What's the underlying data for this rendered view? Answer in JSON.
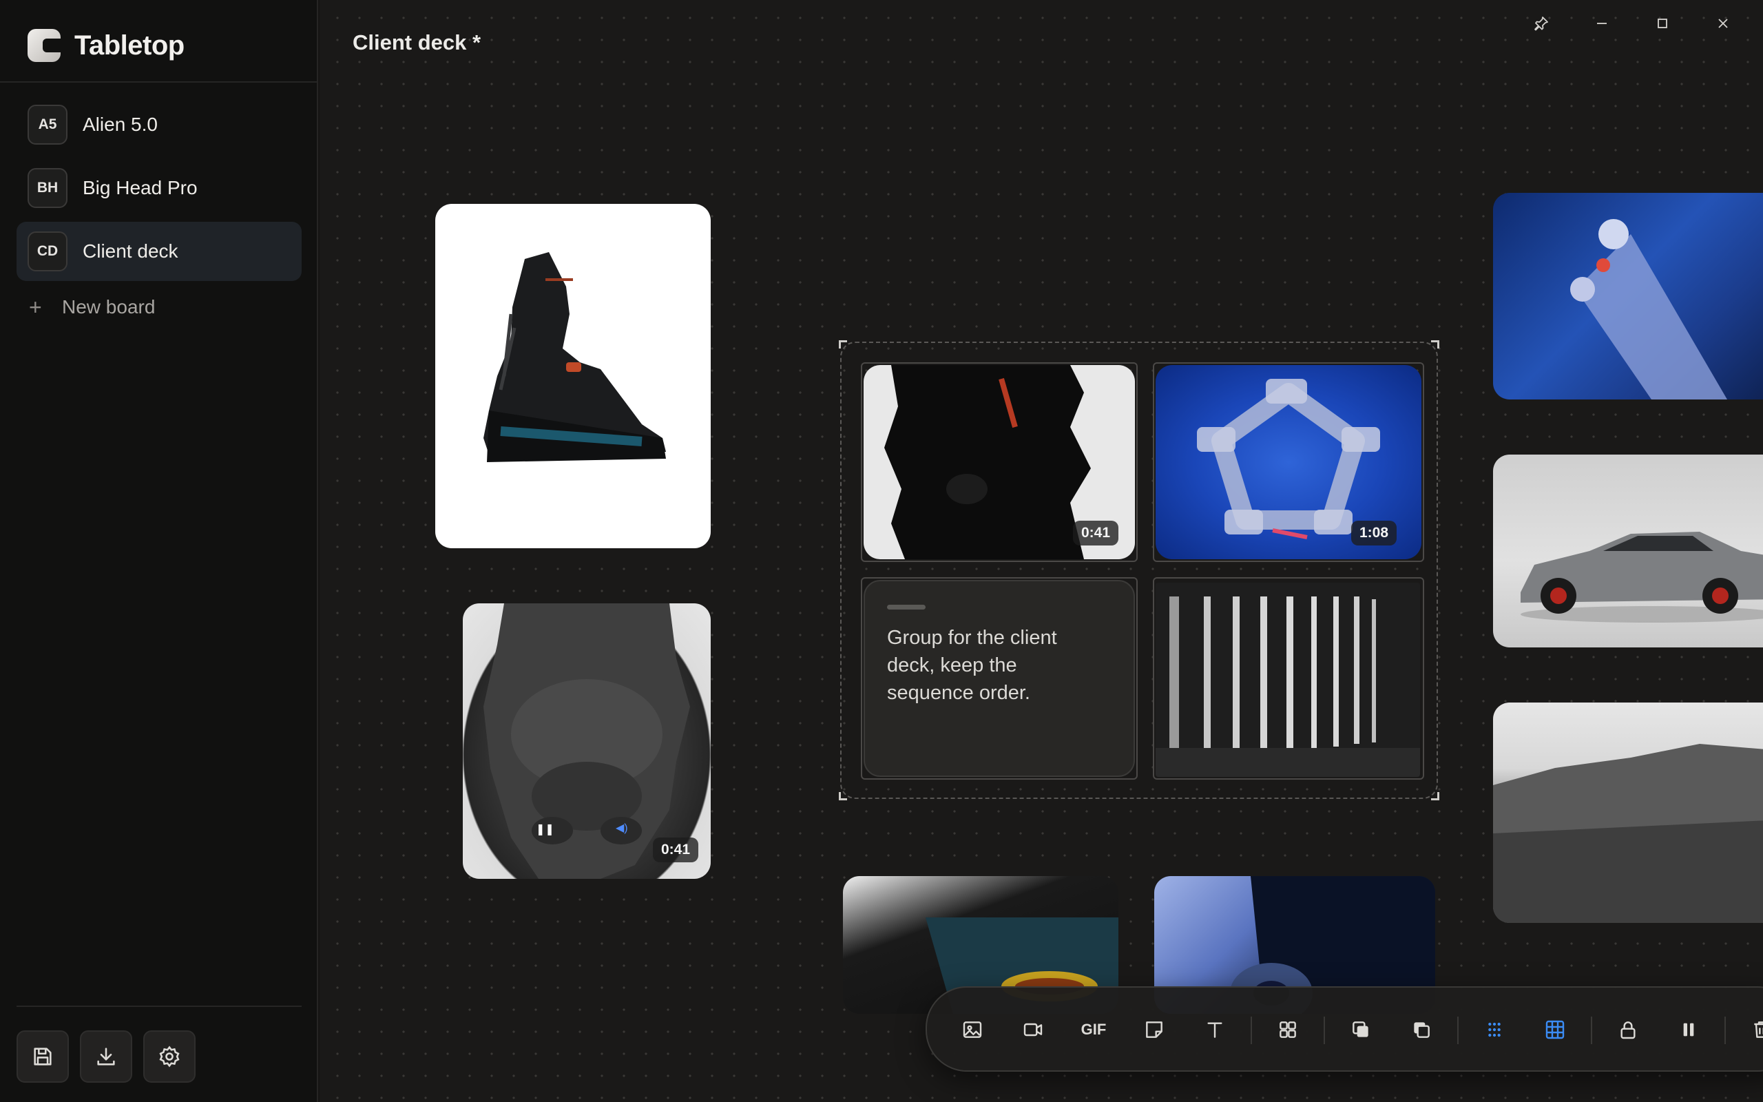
{
  "app": {
    "name": "Tabletop",
    "document_title": "Client deck *"
  },
  "sidebar": {
    "boards": [
      {
        "initials": "A5",
        "label": "Alien 5.0",
        "active": false
      },
      {
        "initials": "BH",
        "label": "Big Head Pro",
        "active": false
      },
      {
        "initials": "CD",
        "label": "Client deck",
        "active": true
      }
    ],
    "new_board_label": "New board",
    "footer_tools": [
      "save-icon",
      "download-icon",
      "settings-icon"
    ]
  },
  "window_controls": [
    "pin-icon",
    "minimize-icon",
    "maximize-icon",
    "close-icon"
  ],
  "canvas": {
    "face_video": {
      "duration": "0:41"
    },
    "group": {
      "boot_video": {
        "duration": "0:41"
      },
      "knot_video": {
        "duration": "1:08"
      },
      "note_text": "Group for the client deck, keep the sequence order."
    }
  },
  "toolbar": {
    "gif_label": "GIF",
    "tools": [
      "image-icon",
      "video-icon",
      "gif",
      "sticky-note-icon",
      "text-icon",
      "group-icon",
      "bring-forward-icon",
      "send-backward-icon",
      "dot-grid-icon",
      "grid-snap-icon",
      "lock-icon",
      "pause-icon",
      "trash-icon"
    ],
    "active_color": "#3b8cf5"
  }
}
